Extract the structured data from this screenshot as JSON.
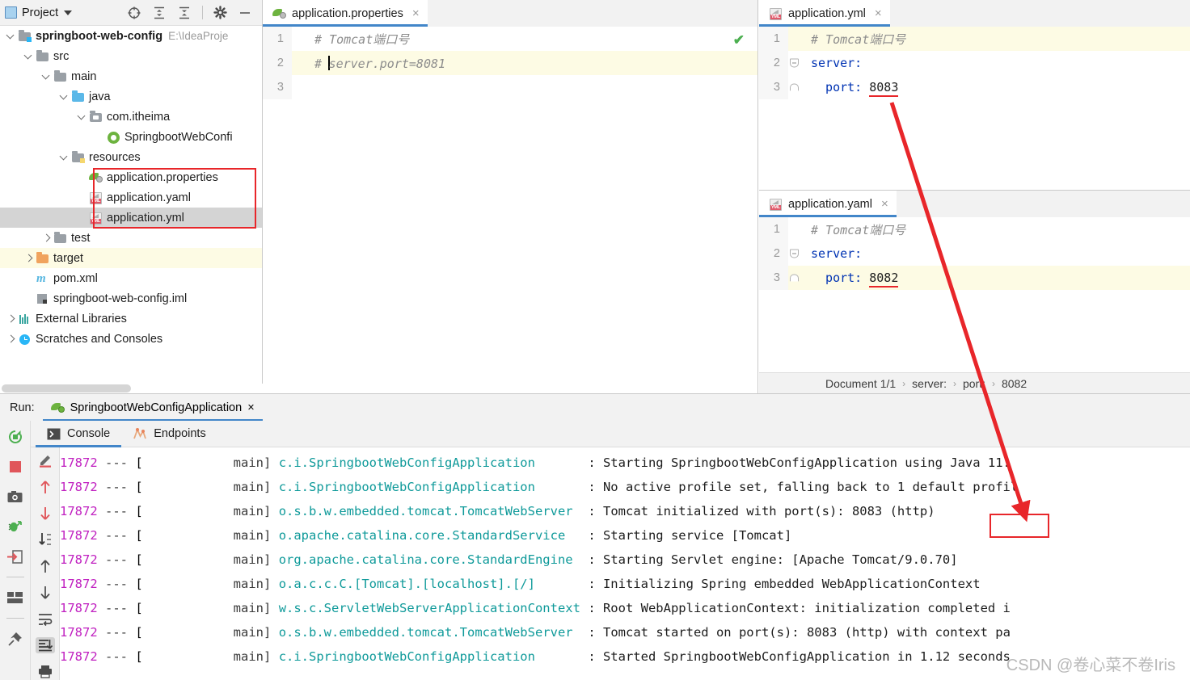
{
  "project_panel": {
    "title": "Project",
    "icons": [
      "project-view-icon",
      "locate-icon",
      "expand-all-icon",
      "collapse-all-icon",
      "settings-gear-icon",
      "minimize-icon"
    ],
    "tree": [
      {
        "label": "springboot-web-config",
        "path": "E:\\IdeaProje",
        "icon": "module-folder-icon",
        "depth": 0,
        "expanded": true,
        "bold": true,
        "state": "normal"
      },
      {
        "label": "src",
        "path": "",
        "icon": "folder-icon",
        "depth": 1,
        "expanded": true,
        "bold": false,
        "state": "normal"
      },
      {
        "label": "main",
        "path": "",
        "icon": "folder-icon",
        "depth": 2,
        "expanded": true,
        "bold": false,
        "state": "normal"
      },
      {
        "label": "java",
        "path": "",
        "icon": "source-folder-icon",
        "depth": 3,
        "expanded": true,
        "bold": false,
        "state": "normal"
      },
      {
        "label": "com.itheima",
        "path": "",
        "icon": "package-icon",
        "depth": 4,
        "expanded": true,
        "bold": false,
        "state": "normal"
      },
      {
        "label": "SpringbootWebConfi",
        "path": "",
        "icon": "spring-class-icon",
        "depth": 5,
        "expanded": null,
        "bold": false,
        "state": "normal"
      },
      {
        "label": "resources",
        "path": "",
        "icon": "resources-folder-icon",
        "depth": 3,
        "expanded": true,
        "bold": false,
        "state": "normal"
      },
      {
        "label": "application.properties",
        "path": "",
        "icon": "spring-properties-icon",
        "depth": 4,
        "expanded": null,
        "bold": false,
        "state": "normal"
      },
      {
        "label": "application.yaml",
        "path": "",
        "icon": "yml-file-icon",
        "depth": 4,
        "expanded": null,
        "bold": false,
        "state": "normal"
      },
      {
        "label": "application.yml",
        "path": "",
        "icon": "yml-file-icon",
        "depth": 4,
        "expanded": null,
        "bold": false,
        "state": "selected"
      },
      {
        "label": "test",
        "path": "",
        "icon": "folder-icon",
        "depth": 2,
        "expanded": false,
        "bold": false,
        "state": "normal"
      },
      {
        "label": "target",
        "path": "",
        "icon": "target-folder-icon",
        "depth": 1,
        "expanded": false,
        "bold": false,
        "state": "highlight"
      },
      {
        "label": "pom.xml",
        "path": "",
        "icon": "maven-icon",
        "depth": 1,
        "expanded": null,
        "bold": false,
        "state": "normal"
      },
      {
        "label": "springboot-web-config.iml",
        "path": "",
        "icon": "iml-icon",
        "depth": 1,
        "expanded": null,
        "bold": false,
        "state": "normal"
      },
      {
        "label": "External Libraries",
        "path": "",
        "icon": "libraries-icon",
        "depth": 0,
        "expanded": false,
        "bold": false,
        "state": "normal"
      },
      {
        "label": "Scratches and Consoles",
        "path": "",
        "icon": "scratches-icon",
        "depth": 0,
        "expanded": false,
        "bold": false,
        "state": "normal"
      }
    ]
  },
  "editor_main": {
    "tab": {
      "label": "application.properties",
      "icon": "spring-properties-icon",
      "close": "×"
    },
    "lines": [
      {
        "num": "1",
        "comment": "# Tomcat端口号",
        "highlight": false,
        "caret": false
      },
      {
        "num": "2",
        "comment": "# server.port=8081",
        "highlight": true,
        "caret": true
      },
      {
        "num": "3",
        "comment": "",
        "highlight": false,
        "caret": false
      }
    ],
    "inspection_badge": "✔"
  },
  "editor_right_top": {
    "tab": {
      "label": "application.yml",
      "icon": "yml-file-icon",
      "close": "×"
    },
    "lines": [
      {
        "num": "1",
        "kind": "comment",
        "text": "# Tomcat端口号",
        "highlight": true
      },
      {
        "num": "2",
        "kind": "key",
        "key": "server:",
        "value": "",
        "highlight": false
      },
      {
        "num": "3",
        "kind": "keyval",
        "key": "  port:",
        "value": "8083",
        "highlight": false
      }
    ]
  },
  "editor_right_bottom": {
    "tab": {
      "label": "application.yaml",
      "icon": "yml-file-icon",
      "close": "×"
    },
    "lines": [
      {
        "num": "1",
        "kind": "comment",
        "text": "# Tomcat端口号",
        "highlight": false
      },
      {
        "num": "2",
        "kind": "key",
        "key": "server:",
        "value": "",
        "highlight": false
      },
      {
        "num": "3",
        "kind": "keyval",
        "key": "  port:",
        "value": "8082",
        "highlight": true
      }
    ],
    "breadcrumb": [
      "Document 1/1",
      "server:",
      "port:",
      "8082"
    ]
  },
  "run_panel": {
    "run_label": "Run:",
    "config_tab": {
      "label": "SpringbootWebConfigApplication",
      "icon": "spring-run-icon",
      "close": "×"
    },
    "sub_tabs": [
      {
        "label": "Console",
        "icon": "console-icon",
        "active": true
      },
      {
        "label": "Endpoints",
        "icon": "endpoints-icon",
        "active": false
      }
    ],
    "left_toolbar": [
      "rerun-icon",
      "stop-icon",
      "screenshot-icon",
      "debug-icon",
      "export-icon",
      "layout-icon",
      "pin-icon"
    ],
    "console_toolbar": [
      "edit-icon",
      "up-arrow-icon",
      "down-arrow-icon",
      "sort-icon",
      "prev-icon",
      "next-icon",
      "soft-wrap-icon",
      "scroll-to-end-icon",
      "print-icon"
    ],
    "console_lines": [
      {
        "pid": "17872",
        "sep": "---",
        "thread": "main]",
        "logger": "c.i.SpringbootWebConfigApplication",
        "msg": ": Starting SpringbootWebConfigApplication using Java 11."
      },
      {
        "pid": "17872",
        "sep": "---",
        "thread": "main]",
        "logger": "c.i.SpringbootWebConfigApplication",
        "msg": ": No active profile set, falling back to 1 default profil"
      },
      {
        "pid": "17872",
        "sep": "---",
        "thread": "main]",
        "logger": "o.s.b.w.embedded.tomcat.TomcatWebServer",
        "msg": ": Tomcat initialized with port(s): 8083 (http)"
      },
      {
        "pid": "17872",
        "sep": "---",
        "thread": "main]",
        "logger": "o.apache.catalina.core.StandardService",
        "msg": ": Starting service [Tomcat]"
      },
      {
        "pid": "17872",
        "sep": "---",
        "thread": "main]",
        "logger": "org.apache.catalina.core.StandardEngine",
        "msg": ": Starting Servlet engine: [Apache Tomcat/9.0.70]"
      },
      {
        "pid": "17872",
        "sep": "---",
        "thread": "main]",
        "logger": "o.a.c.c.C.[Tomcat].[localhost].[/]",
        "msg": ": Initializing Spring embedded WebApplicationContext"
      },
      {
        "pid": "17872",
        "sep": "---",
        "thread": "main]",
        "logger": "w.s.c.ServletWebServerApplicationContext",
        "msg": ": Root WebApplicationContext: initialization completed i"
      },
      {
        "pid": "17872",
        "sep": "---",
        "thread": "main]",
        "logger": "o.s.b.w.embedded.tomcat.TomcatWebServer",
        "msg": ": Tomcat started on port(s): 8083 (http) with context pa"
      },
      {
        "pid": "17872",
        "sep": "---",
        "thread": "main]",
        "logger": "c.i.SpringbootWebConfigApplication",
        "msg": ": Started SpringbootWebConfigApplication in 1.12 seconds"
      }
    ]
  },
  "annotations": {
    "arrow_color": "#e8262a",
    "highlight_boxes": [
      "config-files-box",
      "console-port-box"
    ],
    "underlines": [
      "yml-port-8083",
      "yaml-port-8082"
    ]
  },
  "watermark": "CSDN @卷心菜不卷Iris"
}
